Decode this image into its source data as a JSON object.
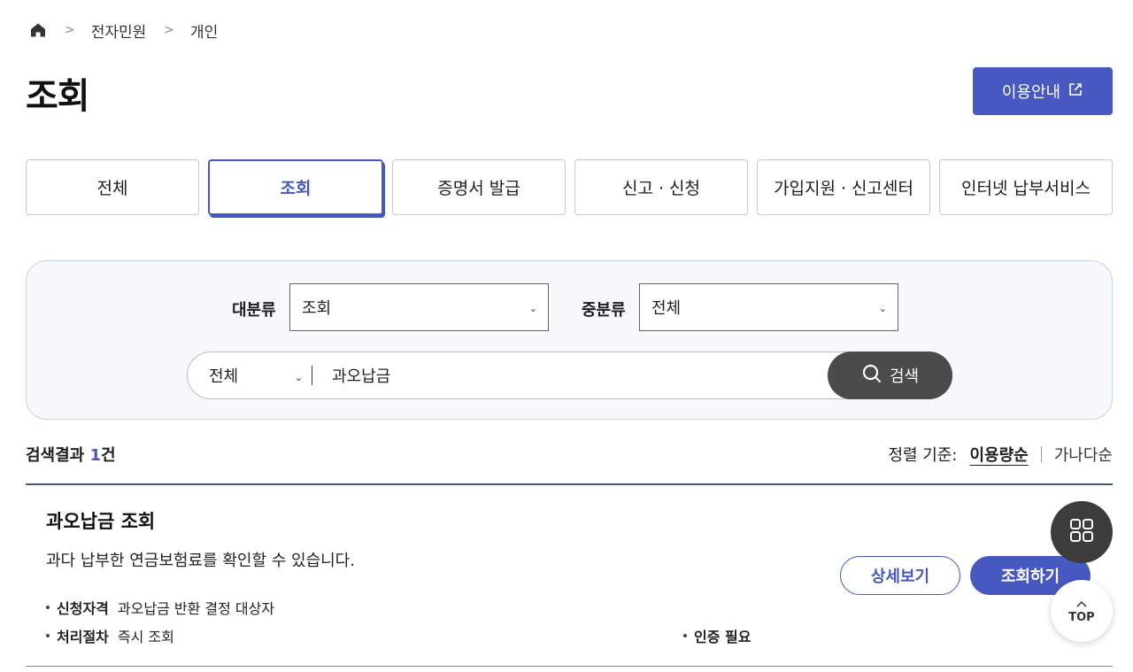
{
  "breadcrumb": {
    "home_icon": "home-icon",
    "level1": "전자민원",
    "level2": "개인",
    "separator": ">"
  },
  "page": {
    "title": "조회"
  },
  "guide_button": {
    "label": "이용안내",
    "icon": "external-link-icon"
  },
  "tabs": [
    {
      "label": "전체",
      "active": false
    },
    {
      "label": "조회",
      "active": true
    },
    {
      "label": "증명서 발급",
      "active": false
    },
    {
      "label": "신고 · 신청",
      "active": false
    },
    {
      "label": "가입지원 · 신고센터",
      "active": false
    },
    {
      "label": "인터넷 납부서비스",
      "active": false
    }
  ],
  "filters": {
    "major_label": "대분류",
    "major_value": "조회",
    "minor_label": "중분류",
    "minor_value": "전체"
  },
  "search": {
    "scope_value": "전체",
    "query": "과오납금",
    "button_label": "검색"
  },
  "results": {
    "prefix": "검색결과 ",
    "count": "1",
    "suffix": "건",
    "sort_label": "정렬 기준:",
    "sort_active": "이용량순",
    "sort_other": "가나다순"
  },
  "item": {
    "title": "과오납금 조회",
    "description": "과다 납부한 연금보험료를 확인할 수 있습니다.",
    "eligibility_label": "신청자격",
    "eligibility_value": "과오납금 반환 결정 대상자",
    "process_label": "처리절차",
    "process_value": "즉시 조회",
    "auth_label": "인증 필요",
    "detail_button": "상세보기",
    "action_button": "조회하기"
  },
  "fab": {
    "menu_icon": "grid-icon",
    "top_label": "TOP"
  },
  "colors": {
    "primary": "#4759c0",
    "dark": "#4b4b4b",
    "search_bg": "#f6f8fc"
  }
}
